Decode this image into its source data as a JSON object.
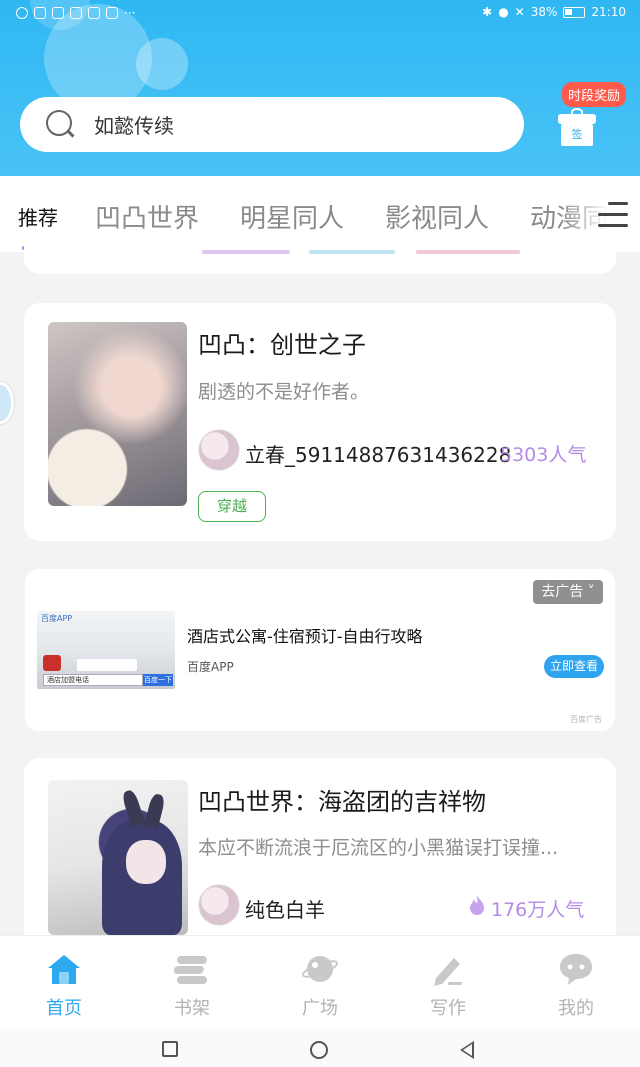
{
  "status_bar": {
    "battery": "38%",
    "time": "21:10"
  },
  "search": {
    "placeholder": "如懿传续"
  },
  "reward": {
    "tag": "时段奖励",
    "gift_text": "签"
  },
  "tabs": [
    {
      "label": "推荐",
      "active": true
    },
    {
      "label": "凹凸世界",
      "active": false
    },
    {
      "label": "明星同人",
      "active": false
    },
    {
      "label": "影视同人",
      "active": false
    },
    {
      "label": "动漫同人",
      "active": false
    }
  ],
  "books": [
    {
      "title": "凹凸：创世之子",
      "description": "剧透的不是好作者。",
      "author": "立春_59114887631436228",
      "popularity": "5303人气",
      "tag": "穿越"
    },
    {
      "title": "凹凸世界：海盗团的吉祥物",
      "description": "本应不断流浪于厄流区的小黑猫误打误撞...",
      "author": "纯色白羊",
      "popularity": "176万人气"
    }
  ],
  "ad": {
    "title": "酒店式公寓-住宿预订-自由行攻略",
    "source": "百度APP",
    "cta": "立即查看",
    "close": "去广告 ˅",
    "mark": "百度广告",
    "image_label": "百度APP",
    "image_search": "酒店加盟电话",
    "image_button": "百度一下"
  },
  "bottom_nav": [
    {
      "label": "首页",
      "icon": "home-icon",
      "active": true
    },
    {
      "label": "书架",
      "icon": "bookshelf-icon",
      "active": false
    },
    {
      "label": "广场",
      "icon": "planet-icon",
      "active": false
    },
    {
      "label": "写作",
      "icon": "pen-icon",
      "active": false
    },
    {
      "label": "我的",
      "icon": "chat-bubble-icon",
      "active": false
    }
  ],
  "colors": {
    "accent_blue": "#2ea8ef",
    "tab_underline": "#a78bfa",
    "popularity": "#b48be6",
    "genre_tag": "#4caf50"
  }
}
